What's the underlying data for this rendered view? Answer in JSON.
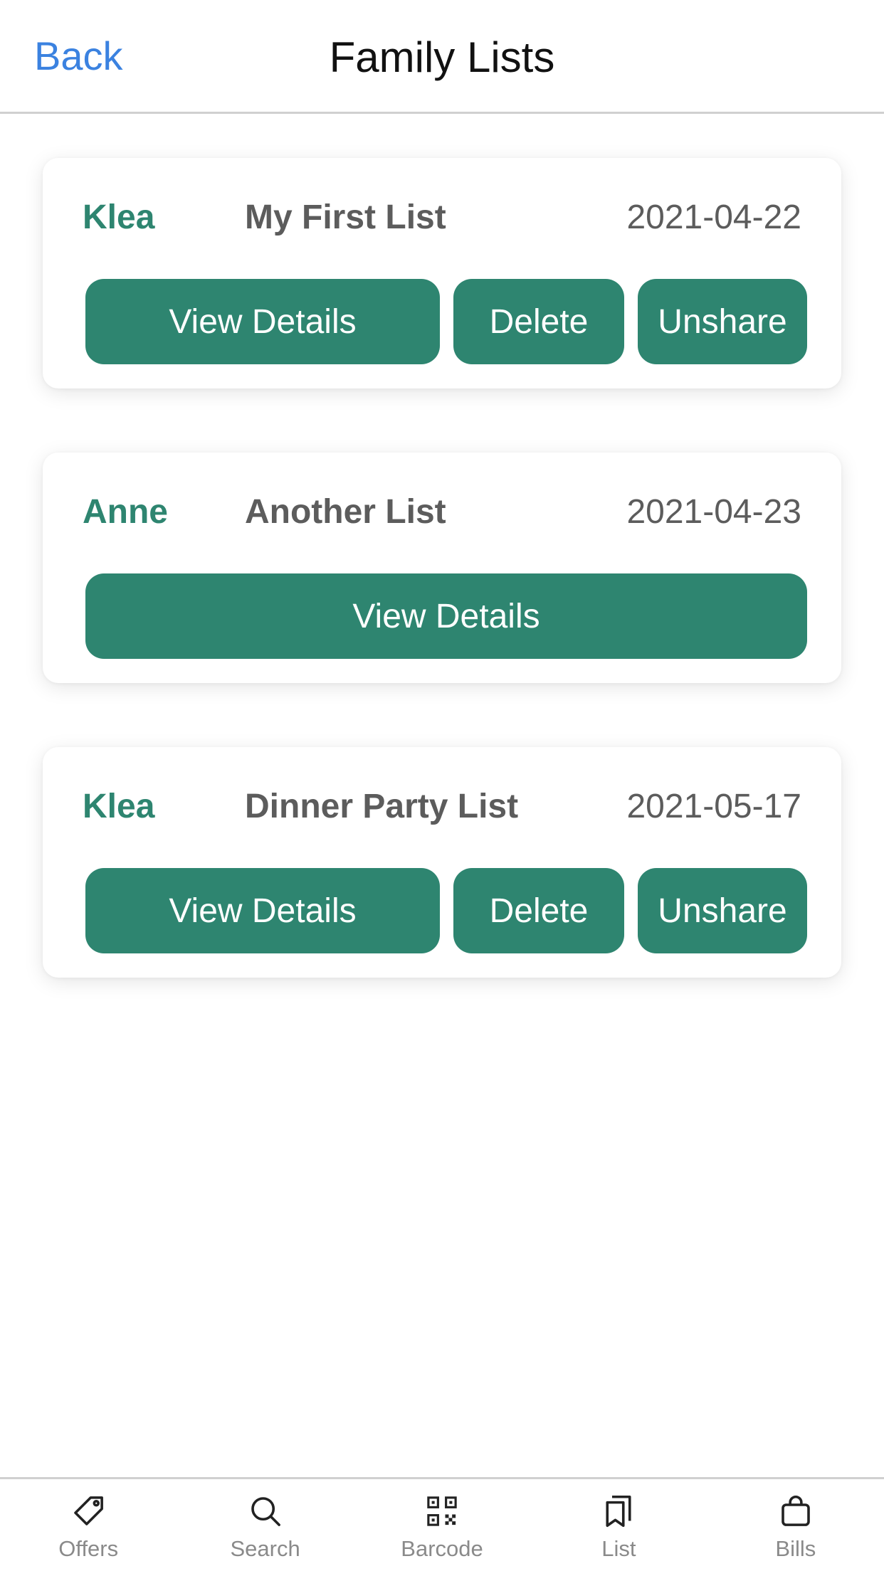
{
  "header": {
    "back_label": "Back",
    "title": "Family Lists"
  },
  "lists": [
    {
      "owner": "Klea",
      "name": "My First List",
      "date": "2021-04-22",
      "view_label": "View Details",
      "delete_label": "Delete",
      "unshare_label": "Unshare"
    },
    {
      "owner": "Anne",
      "name": "Another List",
      "date": "2021-04-23",
      "view_label": "View Details"
    },
    {
      "owner": "Klea",
      "name": "Dinner Party List",
      "date": "2021-05-17",
      "view_label": "View Details",
      "delete_label": "Delete",
      "unshare_label": "Unshare"
    }
  ],
  "nav": {
    "items": [
      {
        "label": "Offers",
        "icon": "tag-icon"
      },
      {
        "label": "Search",
        "icon": "search-icon"
      },
      {
        "label": "Barcode",
        "icon": "qr-code-icon"
      },
      {
        "label": "List",
        "icon": "bookmarks-icon"
      },
      {
        "label": "Bills",
        "icon": "shopping-bag-icon"
      }
    ]
  },
  "colors": {
    "accent": "#2e8570",
    "link": "#3b82e0",
    "muted_text": "#5c5c5c",
    "nav_text": "#8a8a8a"
  }
}
